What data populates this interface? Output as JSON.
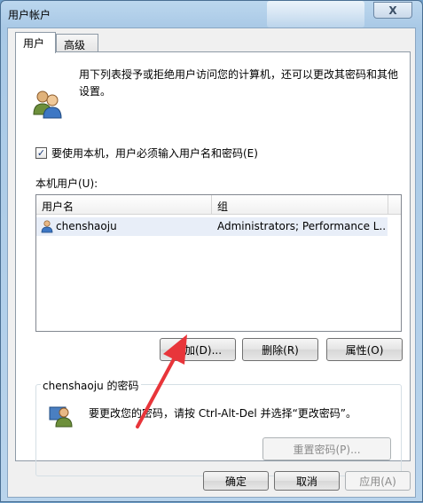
{
  "window": {
    "title": "用户帐户",
    "close_glyph": "X"
  },
  "tabs": [
    {
      "label": "用户",
      "active": true
    },
    {
      "label": "高级",
      "active": false
    }
  ],
  "intro": {
    "icon": "users-icon",
    "text": "用下列表授予或拒绝用户访问您的计算机，还可以更改其密码和其他设置。"
  },
  "require_login": {
    "checked": true,
    "check_glyph": "✓",
    "label": "要使用本机，用户必须输入用户名和密码(E)"
  },
  "users_section": {
    "label": "本机用户(U):",
    "columns": [
      "用户名",
      "组"
    ],
    "rows": [
      {
        "icon": "user-icon",
        "name": "chenshaoju",
        "group": "Administrators; Performance L..."
      }
    ]
  },
  "user_buttons": {
    "add": "添加(D)...",
    "remove": "删除(R)",
    "properties": "属性(O)"
  },
  "password_group": {
    "title": "chenshaoju 的密码",
    "icon": "user-key-icon",
    "text": "要更改您的密码，请按 Ctrl-Alt-Del 并选择“更改密码”。",
    "reset_button": "重置密码(P)..."
  },
  "dialog_buttons": {
    "ok": "确定",
    "cancel": "取消",
    "apply": "应用(A)"
  },
  "annotation": {
    "type": "red-arrow",
    "color": "#e8353a",
    "points_to": "add-user-button"
  }
}
